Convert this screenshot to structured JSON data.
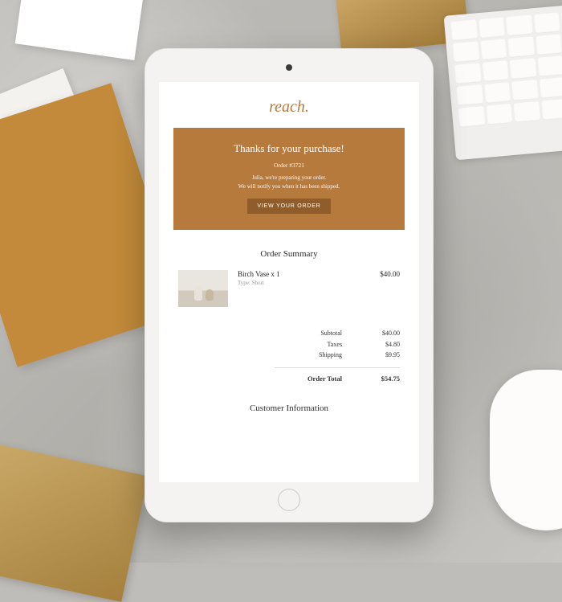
{
  "brand": {
    "logo": "reach."
  },
  "hero": {
    "title": "Thanks for your purchase!",
    "order_label": "Order #3721",
    "message_line1": "Julia, we're preparing your order.",
    "message_line2": "We will notify you when it has been shipped.",
    "button_label": "VIEW YOUR ORDER"
  },
  "summary": {
    "heading": "Order Summary",
    "item": {
      "name": "Birch Vase x 1",
      "type": "Type: Short",
      "price": "$40.00"
    },
    "lines": {
      "subtotal_label": "Subtotal",
      "subtotal_value": "$40.00",
      "taxes_label": "Taxes",
      "taxes_value": "$4.80",
      "shipping_label": "Shipping",
      "shipping_value": "$9.95",
      "total_label": "Order Total",
      "total_value": "$54.75"
    }
  },
  "customer": {
    "heading": "Customer Information"
  }
}
